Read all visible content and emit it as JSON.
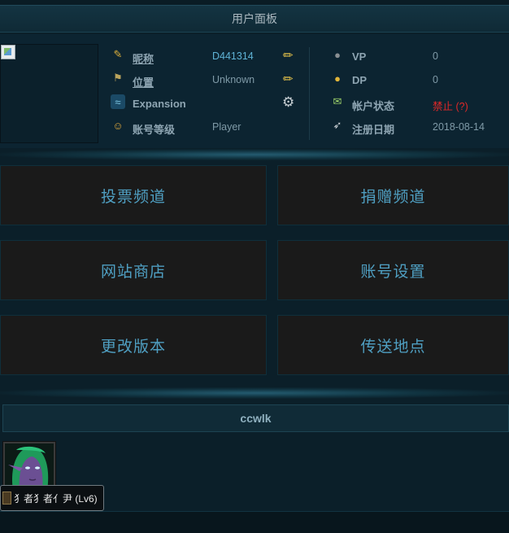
{
  "panel": {
    "title": "用户面板"
  },
  "profile": {
    "left": [
      {
        "icon": "nickname-icon",
        "label": "昵称",
        "value": "D441314",
        "action": "edit-icon"
      },
      {
        "icon": "location-icon",
        "label": "位置",
        "value": "Unknown",
        "action": "edit-icon"
      },
      {
        "icon": "expansion-icon",
        "label": "Expansion",
        "value": "",
        "action": "gear-icon"
      },
      {
        "icon": "account-level-icon",
        "label": "账号等级",
        "value": "Player",
        "action": ""
      }
    ],
    "right": [
      {
        "icon": "vp-coin-icon",
        "label": "VP",
        "value": "0"
      },
      {
        "icon": "dp-coin-icon",
        "label": "DP",
        "value": "0"
      },
      {
        "icon": "account-status-icon",
        "label": "帐户状态",
        "value": "禁止 (?)"
      },
      {
        "icon": "register-date-icon",
        "label": "注册日期",
        "value": "2018-08-14"
      }
    ]
  },
  "menu": [
    {
      "label": "投票频道"
    },
    {
      "label": "捐赠频道"
    },
    {
      "label": "网站商店"
    },
    {
      "label": "账号设置"
    },
    {
      "label": "更改版本"
    },
    {
      "label": "传送地点"
    }
  ],
  "user": {
    "name": "ccwlk"
  },
  "character": {
    "tooltip": "犭者犭者亻尹 (Lv6)"
  },
  "colors": {
    "accent": "#4f9fc2",
    "name": "#5fb3d6",
    "banned": "#e02828",
    "background": "#0b1f29"
  }
}
